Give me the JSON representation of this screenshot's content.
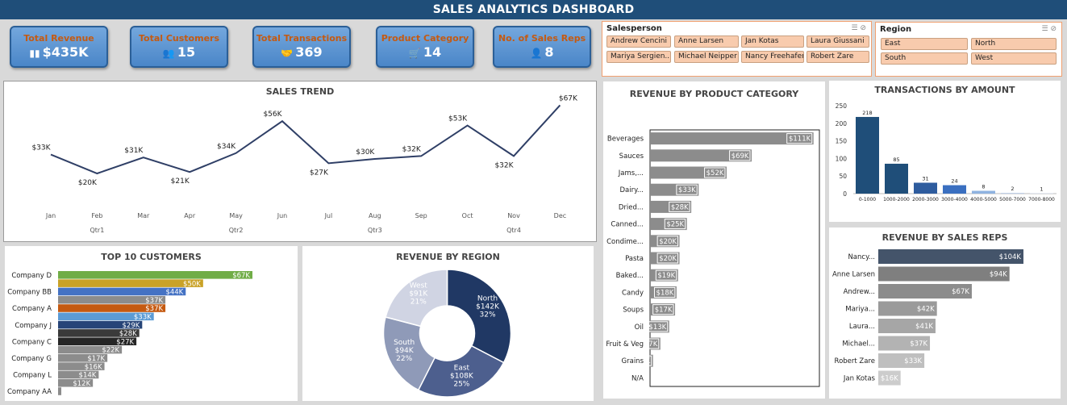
{
  "header": {
    "title": "SALES ANALYTICS DASHBOARD"
  },
  "kpis": [
    {
      "label": "Total Revenue",
      "value": "$435K",
      "icon": "bar-chart-icon"
    },
    {
      "label": "Total Customers",
      "value": "15",
      "icon": "users-icon"
    },
    {
      "label": "Total Transactions",
      "value": "369",
      "icon": "handshake-icon"
    },
    {
      "label": "Product Category",
      "value": "14",
      "icon": "cart-icon"
    },
    {
      "label": "No. of Sales Reps",
      "value": "8",
      "icon": "person-icon"
    }
  ],
  "salesperson_slicer": {
    "title": "Salesperson",
    "items": [
      "Andrew Cencini",
      "Anne Larsen",
      "Jan Kotas",
      "Laura Giussani",
      "Mariya Sergien...",
      "Michael Neipper",
      "Nancy Freehafer",
      "Robert Zare"
    ]
  },
  "region_slicer": {
    "title": "Region",
    "items": [
      "East",
      "North",
      "South",
      "West"
    ]
  },
  "colors": {
    "navy": "#1f4e79",
    "line": "#2f3f66",
    "gray": "#8c8c8c",
    "slicer": "#f8cbad"
  },
  "chart_data": [
    {
      "id": "sales_trend",
      "type": "line",
      "title": "SALES TREND",
      "x": [
        "Jan",
        "Feb",
        "Mar",
        "Apr",
        "May",
        "Jun",
        "Jul",
        "Aug",
        "Sep",
        "Oct",
        "Nov",
        "Dec"
      ],
      "groups": [
        "Qtr1",
        "Qtr2",
        "Qtr3",
        "Qtr4"
      ],
      "values": [
        33,
        20,
        31,
        21,
        34,
        56,
        27,
        30,
        32,
        53,
        32,
        67
      ],
      "labels": [
        "$33K",
        "$20K",
        "$31K",
        "$21K",
        "$34K",
        "$56K",
        "$27K",
        "$30K",
        "$32K",
        "$53K",
        "$32K",
        "$67K"
      ],
      "ylim": [
        0,
        75
      ],
      "grid": false
    },
    {
      "id": "top_customers",
      "type": "bar",
      "orientation": "horizontal",
      "title": "TOP 10 CUSTOMERS",
      "categories": [
        "Company D",
        "",
        "Company BB",
        "",
        "Company A",
        "",
        "Company J",
        "",
        "Company C",
        "",
        "Company G",
        "",
        "Company L",
        "",
        "Company AA"
      ],
      "values": [
        67,
        50,
        44,
        37,
        37,
        33,
        29,
        28,
        27,
        22,
        17,
        16,
        14,
        12,
        1
      ],
      "labels": [
        "$67K",
        "$50K",
        "$44K",
        "$37K",
        "$37K",
        "$33K",
        "$29K",
        "$28K",
        "$27K",
        "$22K",
        "$17K",
        "$16K",
        "$14K",
        "$12K",
        ""
      ],
      "colors": [
        "#70ad47",
        "#c9a227",
        "#4472c4",
        "#8c8c8c",
        "#c55a11",
        "#5b9bd5",
        "#264478",
        "#3a3a3a",
        "#262626",
        "#8c8c8c",
        "#8c8c8c",
        "#8c8c8c",
        "#8c8c8c",
        "#8c8c8c",
        "#8c8c8c"
      ]
    },
    {
      "id": "revenue_by_region",
      "type": "pie",
      "title": "REVENUE BY REGION",
      "categories": [
        "North",
        "East",
        "South",
        "West"
      ],
      "values": [
        142,
        108,
        94,
        91
      ],
      "value_labels": [
        "$142K",
        "$108K",
        "$94K",
        "$91K"
      ],
      "pct_labels": [
        "32%",
        "25%",
        "22%",
        "21%"
      ],
      "colors": [
        "#203864",
        "#4d5f8e",
        "#8f9ab8",
        "#d0d4e3"
      ]
    },
    {
      "id": "revenue_by_category",
      "type": "bar",
      "orientation": "horizontal",
      "title": "REVENUE BY PRODUCT CATEGORY",
      "categories": [
        "Beverages",
        "Sauces",
        "Jams,...",
        "Dairy...",
        "Dried...",
        "Canned...",
        "Condime...",
        "Pasta",
        "Baked...",
        "Candy",
        "Soups",
        "Oil",
        "Fruit & Veg",
        "Grains",
        "N/A"
      ],
      "values": [
        111,
        69,
        52,
        33,
        28,
        25,
        20,
        20,
        19,
        18,
        17,
        13,
        7,
        2,
        0
      ],
      "labels": [
        "$111K",
        "$69K",
        "$52K",
        "$33K",
        "$28K",
        "$25K",
        "$20K",
        "$20K",
        "$19K",
        "$18K",
        "$17K",
        "$13K",
        "$7K",
        "$2K",
        ""
      ],
      "xlim": [
        0,
        115
      ]
    },
    {
      "id": "transactions_by_amount",
      "type": "bar",
      "title": "TRANSACTIONS BY AMOUNT",
      "categories": [
        "0-1000",
        "1000-2000",
        "2000-3000",
        "3000-4000",
        "4000-5000",
        "5000-7000",
        "7000-8000"
      ],
      "values": [
        218,
        85,
        31,
        24,
        8,
        2,
        1
      ],
      "labels": [
        "218",
        "85",
        "31",
        "24",
        "8",
        "2",
        "1"
      ],
      "yticks": [
        0,
        50,
        100,
        150,
        200,
        250
      ],
      "ylim": [
        0,
        250
      ],
      "colors": [
        "#1f4e79",
        "#1f4e79",
        "#2e5c9e",
        "#3a6fc0",
        "#8fb3e0",
        "#b8cbe8",
        "#cfdcee"
      ]
    },
    {
      "id": "revenue_by_reps",
      "type": "bar",
      "orientation": "horizontal",
      "title": "REVENUE BY SALES REPS",
      "categories": [
        "Nancy...",
        "Anne Larsen",
        "Andrew...",
        "Mariya...",
        "Laura...",
        "Michael...",
        "Robert Zare",
        "Jan Kotas"
      ],
      "values": [
        104,
        94,
        67,
        42,
        41,
        37,
        33,
        16
      ],
      "labels": [
        "$104K",
        "$94K",
        "$67K",
        "$42K",
        "$41K",
        "$37K",
        "$33K",
        "$16K"
      ],
      "colors": [
        "#44546a",
        "#7f7f7f",
        "#8c8c8c",
        "#9a9a9a",
        "#a6a6a6",
        "#b3b3b3",
        "#bfbfbf",
        "#cccccc"
      ]
    }
  ]
}
